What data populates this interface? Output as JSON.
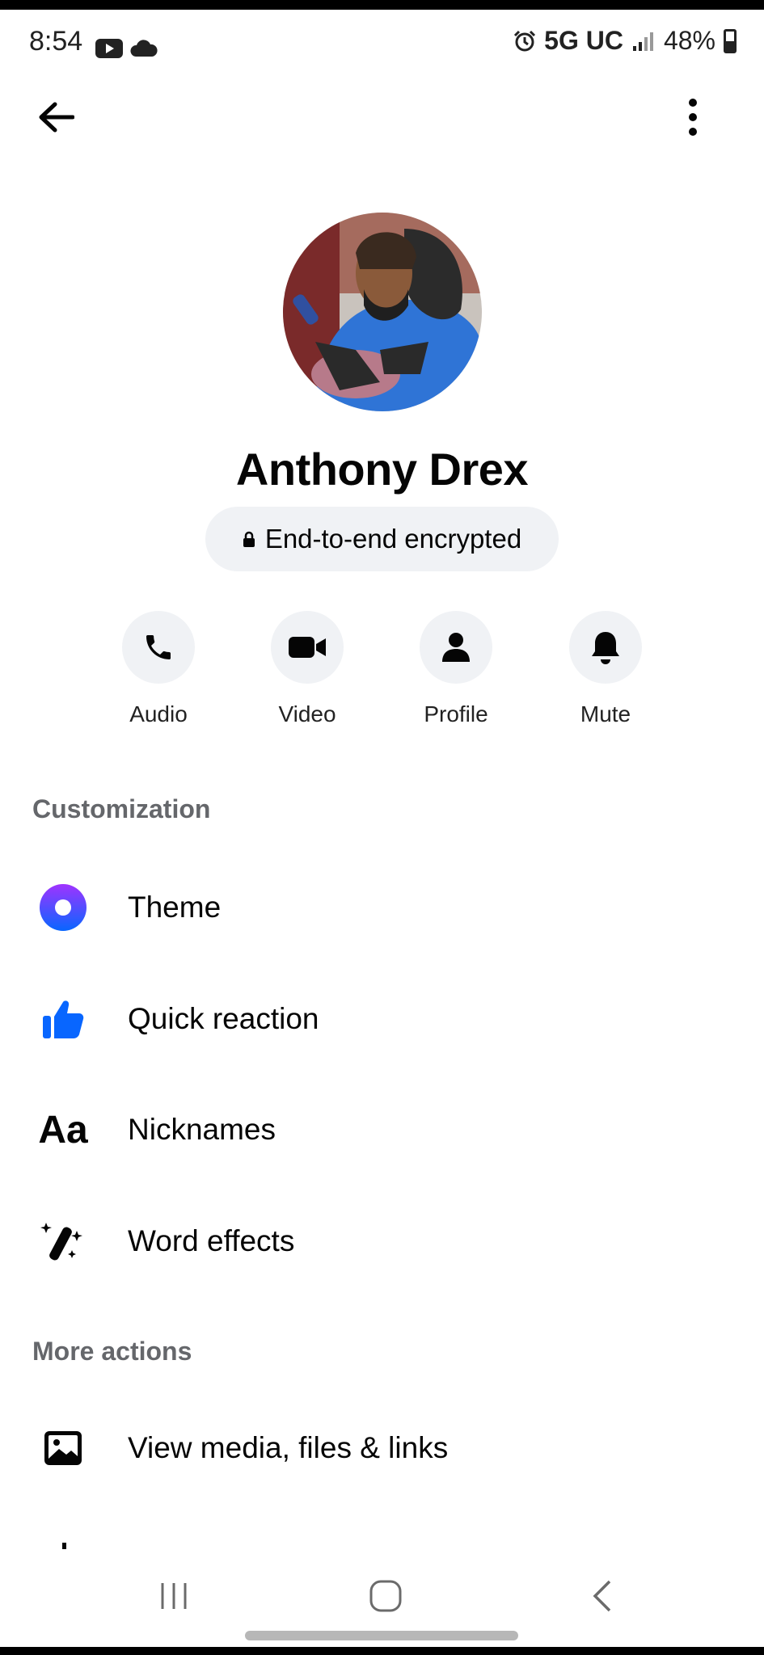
{
  "status_bar": {
    "time": "8:54",
    "network": "5G UC",
    "battery": "48%"
  },
  "contact": {
    "name": "Anthony Drex",
    "encryption_label": "End-to-end encrypted"
  },
  "actions": [
    {
      "label": "Audio",
      "icon": "phone-icon"
    },
    {
      "label": "Video",
      "icon": "video-camera-icon"
    },
    {
      "label": "Profile",
      "icon": "person-icon"
    },
    {
      "label": "Mute",
      "icon": "bell-icon"
    }
  ],
  "sections": {
    "customization": {
      "title": "Customization",
      "items": [
        {
          "label": "Theme",
          "icon": "theme-circle-icon"
        },
        {
          "label": "Quick reaction",
          "icon": "thumbs-up-icon"
        },
        {
          "label": "Nicknames",
          "icon": "aa-text-icon",
          "icon_text": "Aa"
        },
        {
          "label": "Word effects",
          "icon": "magic-wand-icon"
        }
      ]
    },
    "more_actions": {
      "title": "More actions",
      "items": [
        {
          "label": "View media, files & links",
          "icon": "image-icon"
        }
      ]
    }
  },
  "colors": {
    "accent_blue": "#0866ff",
    "theme_gradient_start": "#a033ff",
    "theme_gradient_end": "#0866ff"
  }
}
